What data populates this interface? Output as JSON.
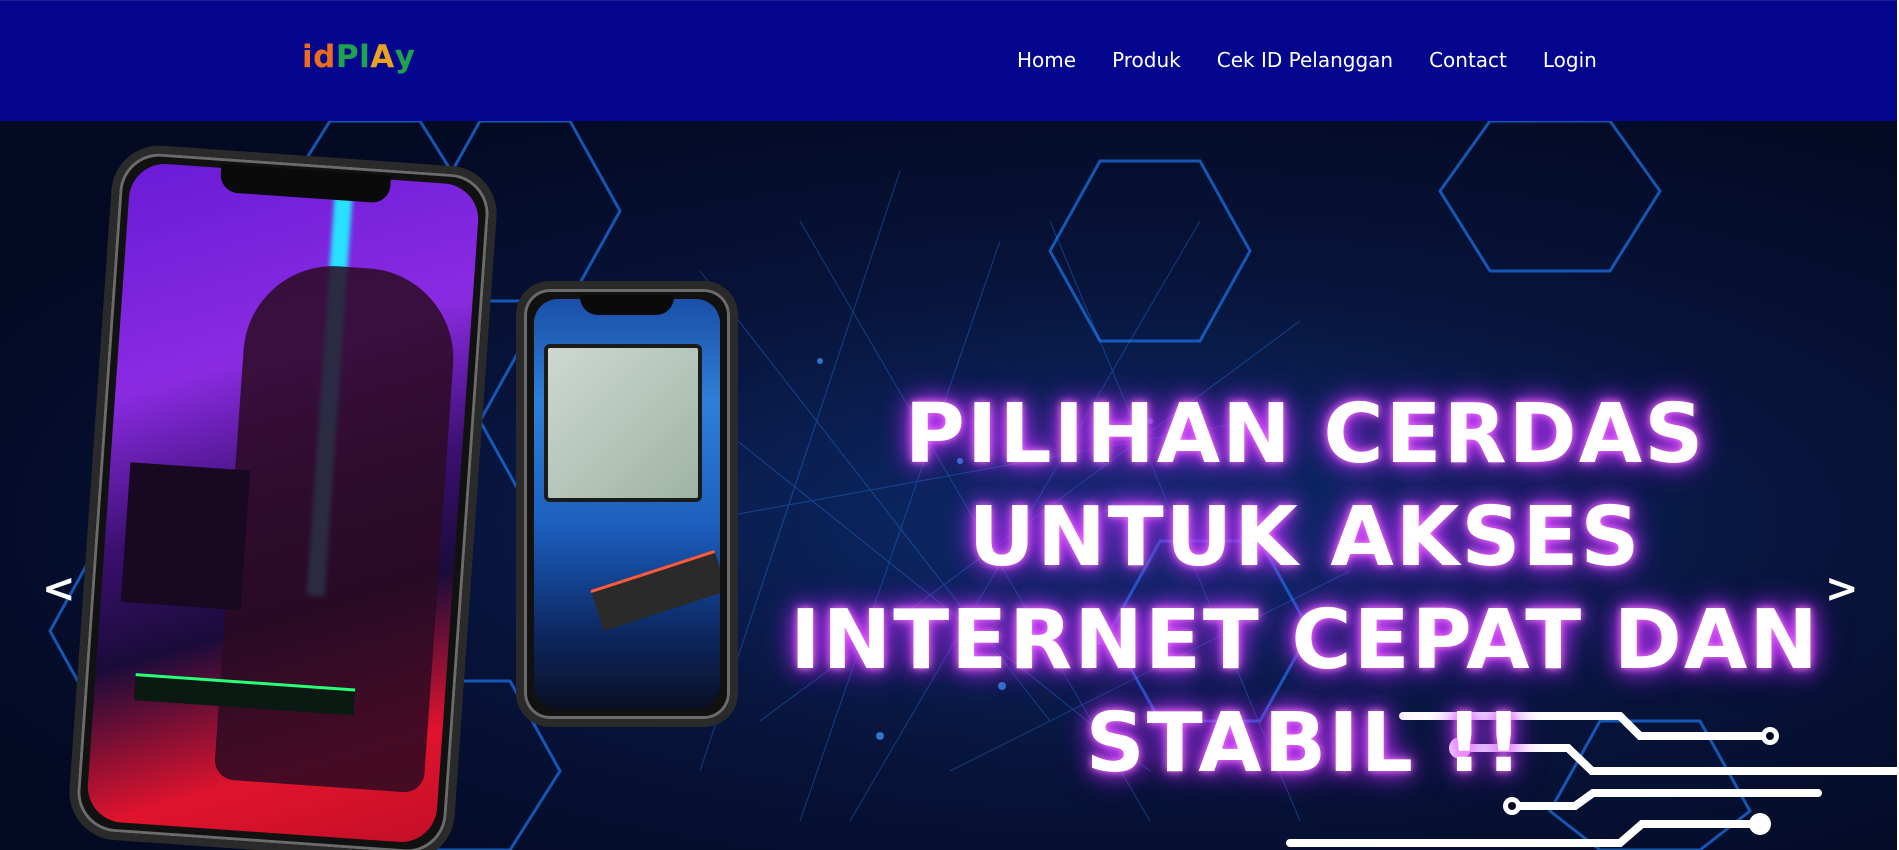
{
  "header": {
    "logo_letters": [
      "i",
      "d",
      "P",
      "l",
      "A",
      "y"
    ],
    "logo_colors": [
      "#ef6b1d",
      "#ef6b1d",
      "#1ea24b",
      "#1ea24b",
      "#e9a31c",
      "#1ea24b"
    ],
    "nav": [
      "Home",
      "Produk",
      "Cek ID Pelanggan",
      "Contact",
      "Login"
    ]
  },
  "hero": {
    "headline_lines": [
      "PILIHAN CERDAS",
      "UNTUK AKSES",
      "INTERNET CEPAT DAN",
      "STABIL !!"
    ],
    "prev_label": "<",
    "next_label": ">"
  },
  "colors": {
    "navbar_bg": "#04068e",
    "glow": "#d13bff"
  }
}
